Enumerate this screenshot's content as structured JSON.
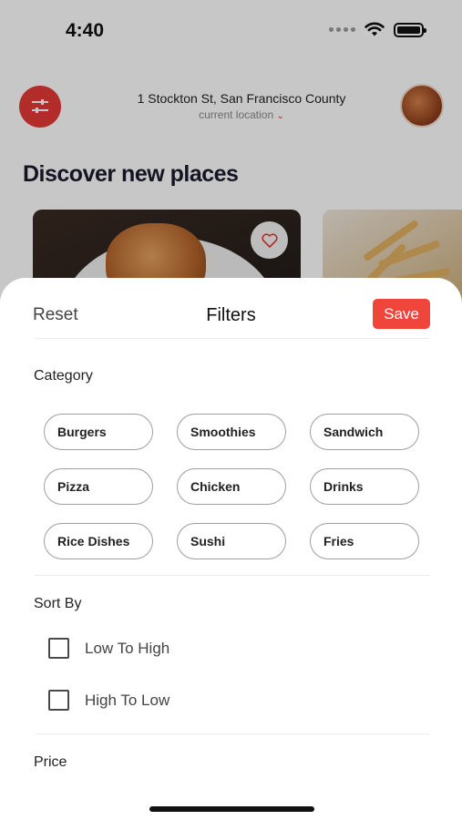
{
  "status": {
    "time": "4:40"
  },
  "header": {
    "address": "1 Stockton St, San Francisco County",
    "location_label": "current location",
    "chevron": "⌄"
  },
  "home": {
    "title": "Discover new places"
  },
  "sheet": {
    "reset_label": "Reset",
    "title": "Filters",
    "save_label": "Save",
    "category_label": "Category",
    "categories": [
      "Burgers",
      "Smoothies",
      "Sandwich",
      "Pizza",
      "Chicken",
      "Drinks",
      "Rice Dishes",
      "Sushi",
      "Fries"
    ],
    "sort_label": "Sort By",
    "sort_options": [
      "Low To High",
      "High To Low"
    ],
    "price_label": "Price"
  },
  "colors": {
    "accent": "#f0453a",
    "fab": "#e53935"
  }
}
